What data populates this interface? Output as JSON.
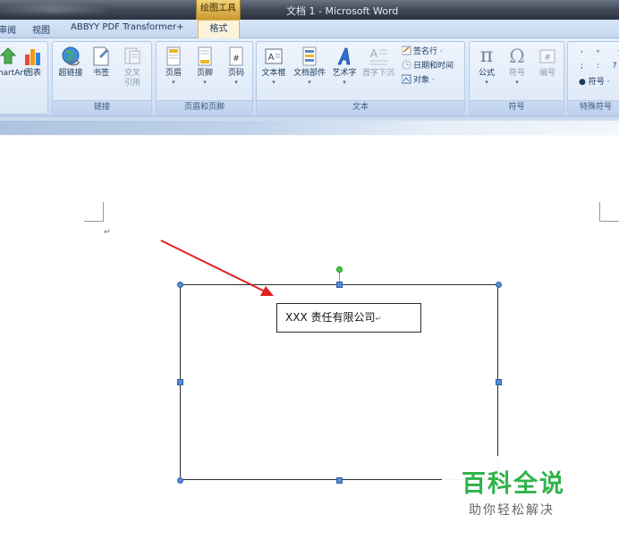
{
  "window": {
    "title": "文档 1 - Microsoft Word",
    "context_tab": "绘图工具"
  },
  "tabs": {
    "review": "审阅",
    "view": "视图",
    "abbyy": "ABBYY PDF Transformer+",
    "format": "格式"
  },
  "ribbon": {
    "illustrations": {
      "smartart": "SmartArt",
      "chart": "图表"
    },
    "links": {
      "label": "链接",
      "hyperlink": "超链接",
      "bookmark": "书签",
      "cross_ref_line1": "交叉",
      "cross_ref_line2": "引用"
    },
    "header_footer": {
      "label": "页眉和页脚",
      "header": "页眉",
      "footer": "页脚",
      "page_number": "页码"
    },
    "text": {
      "label": "文本",
      "textbox": "文本框",
      "quick_parts": "文档部件",
      "wordart": "艺术字",
      "drop_cap": "首字下沉",
      "signature_line": "签名行 ·",
      "date_time": "日期和时间",
      "object": "对象 ·"
    },
    "symbols": {
      "label": "符号",
      "equation": "公式",
      "symbol": "符号",
      "number": "编号"
    },
    "special_symbols": {
      "label": "特殊符号",
      "symbol": "符号 ·"
    }
  },
  "document": {
    "textbox_text": "XXX 责任有限公司"
  },
  "watermark": {
    "title": "百科全说",
    "subtitle": "助你轻松解决"
  },
  "colors": {
    "selection_handle": "#5c8ad6",
    "rotation_handle": "#3dd13d",
    "arrow": "#e02020",
    "watermark_green": "#2fb34a"
  }
}
